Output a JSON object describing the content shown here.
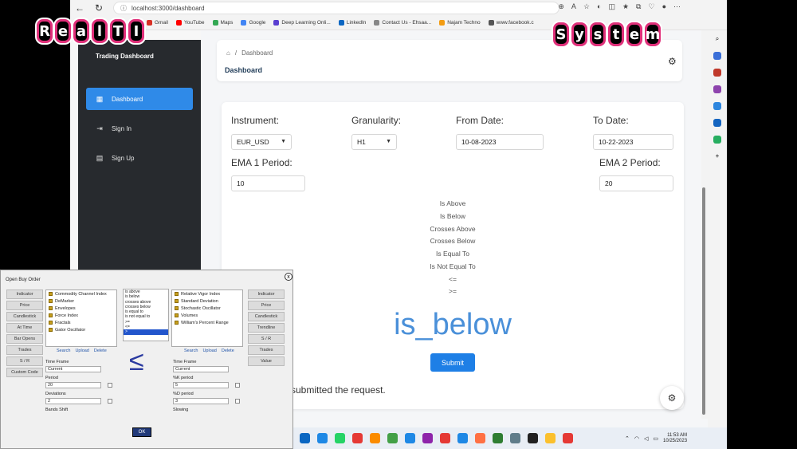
{
  "browser": {
    "url": "localhost:3000/dashboard",
    "bookmarks": [
      {
        "label": "Gmail",
        "color": "#d93025"
      },
      {
        "label": "YouTube",
        "color": "#ff0000"
      },
      {
        "label": "Maps",
        "color": "#34a853"
      },
      {
        "label": "Google",
        "color": "#4285f4"
      },
      {
        "label": "Deep Learning Onli...",
        "color": "#5a3fd0"
      },
      {
        "label": "LinkedIn",
        "color": "#0a66c2"
      },
      {
        "label": "Contact Us - Ehsaa...",
        "color": "#888888"
      },
      {
        "label": "Najam Techno",
        "color": "#f39c12"
      },
      {
        "label": "www.facebook.c",
        "color": "#555555"
      }
    ]
  },
  "logo": {
    "left_word": [
      "R",
      "e",
      "a",
      "l",
      "T",
      "I"
    ],
    "right_word": [
      "S",
      "y",
      "s",
      "t",
      "e",
      "m"
    ]
  },
  "sidebar": {
    "title": "Trading Dashboard",
    "items": [
      {
        "label": "Dashboard",
        "icon": "dashboard-icon",
        "active": true
      },
      {
        "label": "Sign In",
        "icon": "sign-in-icon",
        "active": false
      },
      {
        "label": "Sign Up",
        "icon": "clipboard-icon",
        "active": false
      }
    ]
  },
  "header": {
    "breadcrumb": "Dashboard",
    "title": "Dashboard"
  },
  "form": {
    "instrument_label": "Instrument:",
    "instrument_value": "EUR_USD",
    "granularity_label": "Granularity:",
    "granularity_value": "H1",
    "from_date_label": "From Date:",
    "from_date_value": "10-08-2023",
    "to_date_label": "To Date:",
    "to_date_value": "10-22-2023",
    "ema1_label": "EMA 1 Period:",
    "ema1_value": "10",
    "ema2_label": "EMA 2 Period:",
    "ema2_value": "20",
    "operators": [
      "Is Above",
      "Is Below",
      "Crosses Above",
      "Crosses Below",
      "Is Equal To",
      "Is Not Equal To",
      "<=",
      ">="
    ],
    "result": "is_below",
    "submit_label": "Submit",
    "status_text": "submitted the request."
  },
  "taskbar": {
    "time": "11:53 AM",
    "date": "10/25/2023",
    "icon_colors": [
      "#0a66c2",
      "#1e88e5",
      "#25d366",
      "#e53935",
      "#fb8c00",
      "#43a047",
      "#1e88e5",
      "#8e24aa",
      "#e53935",
      "#1e88e5",
      "#ff7043",
      "#2e7d32",
      "#607d8b",
      "#212121",
      "#fbc02d",
      "#e53935"
    ]
  },
  "dialog": {
    "title": "Open Buy Order",
    "close": "x",
    "left_tabs": [
      "Indicator",
      "Price",
      "Candlestick",
      "At Time",
      "Bar Opens",
      "Trades",
      "S / R",
      "Custom Code"
    ],
    "right_tabs": [
      "Indicator",
      "Price",
      "Candlestick",
      "Trendline",
      "S / R",
      "Trades",
      "Value"
    ],
    "left_list": [
      "Commodity Channel Index",
      "DeMarker",
      "Envelopes",
      "Force Index",
      "Fractals",
      "Gator Oscillator"
    ],
    "right_list": [
      "Relative Vigor Index",
      "Standard Deviation",
      "Stochastic Oscillator",
      "Volumes",
      "William's Percent Range"
    ],
    "operators": [
      "is above",
      "is below",
      "crosses above",
      "crosses below",
      "is equal to",
      "is not equal to",
      ">=",
      "<=",
      ">"
    ],
    "selected_operator_index": 8,
    "links": [
      "Search",
      "Upload",
      "Delete"
    ],
    "left_params": [
      {
        "label": "Time Frame",
        "value": "Current"
      },
      {
        "label": "Period",
        "value": "20"
      },
      {
        "label": "Deviations",
        "value": "2"
      },
      {
        "label": "Bands Shift",
        "value": ""
      }
    ],
    "right_params": [
      {
        "label": "Time Frame",
        "value": "Current"
      },
      {
        "label": "%K period",
        "value": "5"
      },
      {
        "label": "%D period",
        "value": "3"
      },
      {
        "label": "Slowing",
        "value": ""
      }
    ],
    "big_operator": "≤",
    "ok_label": "OK"
  }
}
